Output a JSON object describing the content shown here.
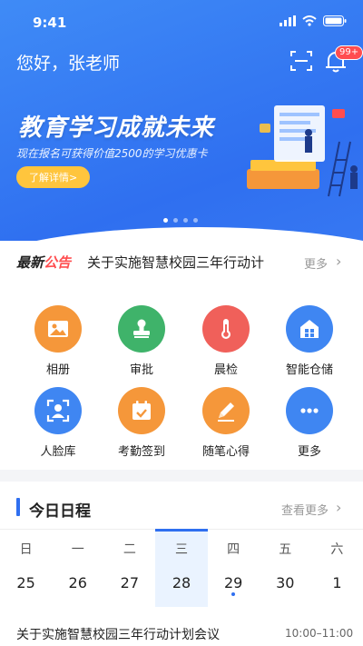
{
  "status": {
    "time": "9:41"
  },
  "header": {
    "greeting": "您好，张老师",
    "badge": "99+"
  },
  "banner": {
    "title": "教育学习成就未来",
    "subtitle": "现在报名可获得价值2500的学习优惠卡",
    "button": "了解详情>",
    "active_index": 0,
    "count": 4
  },
  "notice": {
    "tag_a": "最新",
    "tag_b": "公告",
    "text": "关于实施智慧校园三年行动计",
    "more": "更多",
    "arrow": "›"
  },
  "apps": [
    {
      "label": "相册",
      "icon": "photo-icon",
      "color": "#f5973a"
    },
    {
      "label": "审批",
      "icon": "stamp-icon",
      "color": "#3fb36a"
    },
    {
      "label": "晨检",
      "icon": "thermometer-icon",
      "color": "#f0605a"
    },
    {
      "label": "智能仓储",
      "icon": "warehouse-icon",
      "color": "#3f86f2"
    },
    {
      "label": "人脸库",
      "icon": "face-icon",
      "color": "#3f86f2"
    },
    {
      "label": "考勤签到",
      "icon": "calendar-check-icon",
      "color": "#f5973a"
    },
    {
      "label": "随笔心得",
      "icon": "pencil-icon",
      "color": "#f5973a"
    },
    {
      "label": "更多",
      "icon": "more-icon",
      "color": "#3f86f2"
    }
  ],
  "schedule": {
    "title": "今日日程",
    "more": "查看更多",
    "arrow": "›",
    "days": [
      {
        "name": "日",
        "num": "25"
      },
      {
        "name": "一",
        "num": "26"
      },
      {
        "name": "二",
        "num": "27"
      },
      {
        "name": "三",
        "num": "28"
      },
      {
        "name": "四",
        "num": "29"
      },
      {
        "name": "五",
        "num": "30"
      },
      {
        "name": "六",
        "num": "1"
      }
    ],
    "selected_index": 3,
    "dot_index": 4,
    "event": {
      "title": "关于实施智慧校园三年行动计划会议",
      "time": "10:00–11:00"
    }
  },
  "colors": {
    "accent": "#2f6ff0",
    "badge": "#ff4d4f",
    "highlight": "#ffc53d"
  }
}
